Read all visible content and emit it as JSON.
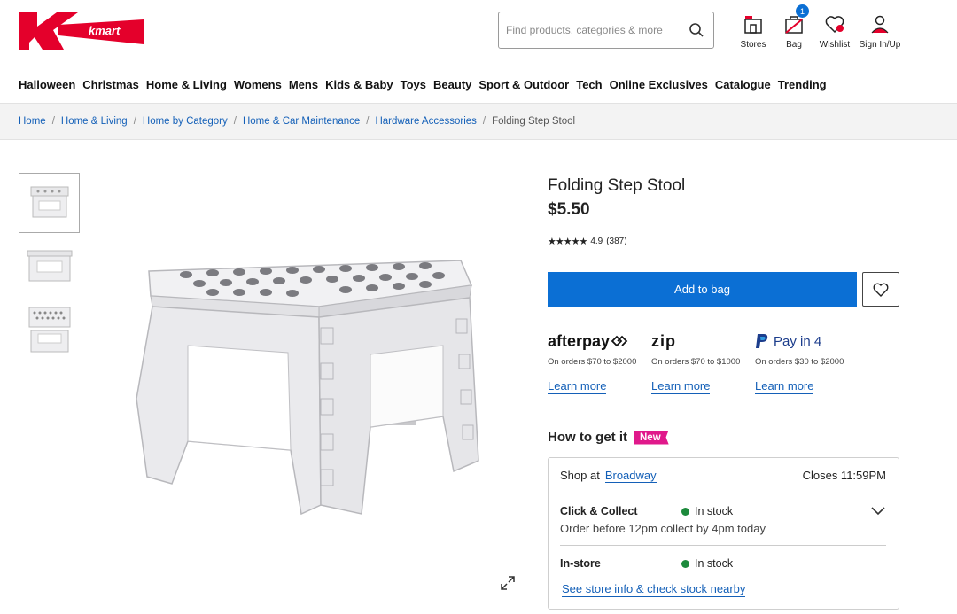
{
  "brand": {
    "name": "kmart",
    "color": "#e4002b"
  },
  "search": {
    "placeholder": "Find products, categories & more"
  },
  "header_icons": [
    {
      "label": "Stores",
      "icon": "store-icon"
    },
    {
      "label": "Bag",
      "icon": "bag-icon",
      "badge": "1"
    },
    {
      "label": "Wishlist",
      "icon": "heart-icon"
    },
    {
      "label": "Sign In/Up",
      "icon": "user-icon"
    }
  ],
  "nav": [
    "Halloween",
    "Christmas",
    "Home & Living",
    "Womens",
    "Mens",
    "Kids & Baby",
    "Toys",
    "Beauty",
    "Sport & Outdoor",
    "Tech",
    "Online Exclusives",
    "Catalogue",
    "Trending"
  ],
  "breadcrumb": {
    "links": [
      "Home",
      "Home & Living",
      "Home by Category",
      "Home & Car Maintenance",
      "Hardware Accessories"
    ],
    "current": "Folding Step Stool"
  },
  "product": {
    "title": "Folding Step Stool",
    "price": "$5.50",
    "stars": "★★★★★",
    "rating": "4.9",
    "reviews": "(387)",
    "add_to_bag": "Add to bag"
  },
  "payments": [
    {
      "name": "afterpay",
      "text": "On orders $70 to $2000",
      "link": "Learn more"
    },
    {
      "name": "zip",
      "text": "On orders $70 to $1000",
      "link": "Learn more"
    },
    {
      "name": "Pay in 4",
      "text": "On orders $30 to $2000",
      "link": "Learn more"
    }
  ],
  "fulfilment": {
    "heading": "How to get it",
    "new_badge": "New",
    "shop_at": "Shop at",
    "store": "Broadway",
    "closes": "Closes 11:59PM",
    "click_collect": {
      "label": "Click & Collect",
      "status": "In stock",
      "note": "Order before 12pm collect by 4pm today"
    },
    "in_store": {
      "label": "In-store",
      "status": "In stock"
    },
    "store_link": "See store info & check stock nearby"
  },
  "colors": {
    "accent": "#0b6fd4",
    "link": "#1460b8",
    "in_stock": "#1d8a3c",
    "new_badge": "#e0198b"
  }
}
